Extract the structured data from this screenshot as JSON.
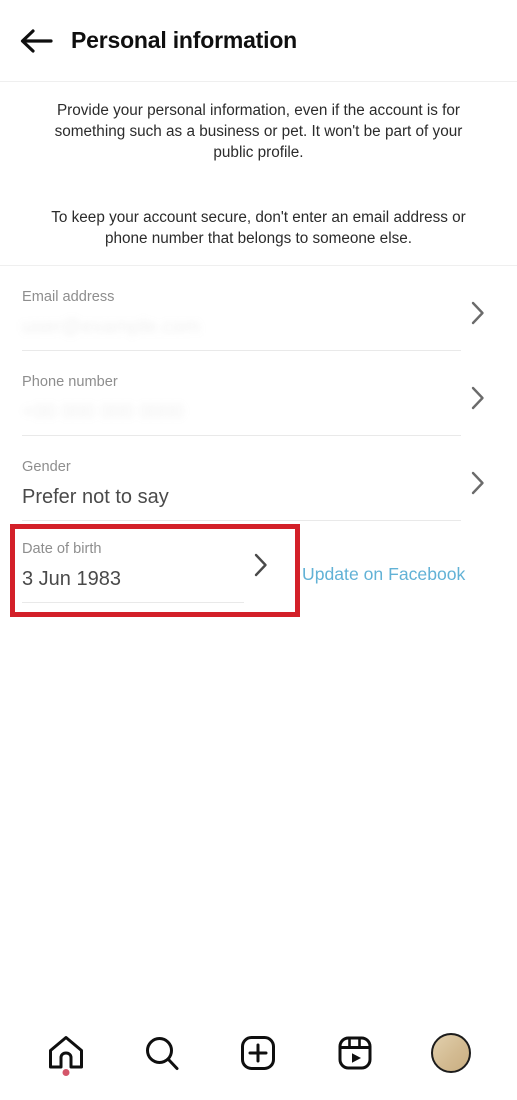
{
  "header": {
    "back_icon": "back-arrow-icon",
    "title": "Personal information"
  },
  "intro": {
    "paragraph_1": "Provide your personal information, even if the account is for something such as a business or pet. It won't be part of your public profile.",
    "paragraph_2": "To keep your account secure, don't enter an email address or phone number that belongs to someone else."
  },
  "fields": [
    {
      "label": "Email address",
      "value": "user@example.com",
      "redacted": true,
      "chevron_icon": "chevron-right-icon"
    },
    {
      "label": "Phone number",
      "value": "+00 000 000 0000",
      "redacted": true,
      "chevron_icon": "chevron-right-icon"
    },
    {
      "label": "Gender",
      "value": "Prefer not to say",
      "redacted": false,
      "chevron_icon": "chevron-right-icon"
    }
  ],
  "date_of_birth": {
    "label": "Date of birth",
    "value": "3 Jun 1983",
    "chevron_icon": "chevron-right-icon",
    "facebook_link": "Update on Facebook",
    "highlight_color": "#d32029",
    "link_color": "#62b2d6"
  },
  "bottom_nav": [
    {
      "name": "home",
      "icon": "home-icon",
      "has_badge": true
    },
    {
      "name": "search",
      "icon": "search-icon",
      "has_badge": false
    },
    {
      "name": "create",
      "icon": "plus-square-icon",
      "has_badge": false
    },
    {
      "name": "reels",
      "icon": "reels-icon",
      "has_badge": false
    },
    {
      "name": "profile",
      "icon": "avatar-icon",
      "has_badge": false
    }
  ]
}
